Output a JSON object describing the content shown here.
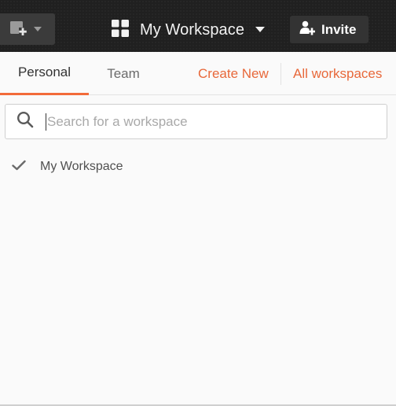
{
  "header": {
    "new_button": {
      "icon": "new-collection-plus-icon",
      "caret": "caret-down-icon"
    },
    "workspace_switcher": {
      "icon": "grid-icon",
      "title": "My Workspace",
      "caret": "caret-down-icon"
    },
    "invite_button": {
      "icon": "add-user-icon",
      "label": "Invite"
    }
  },
  "dropdown": {
    "tabs": [
      {
        "label": "Personal",
        "active": true
      },
      {
        "label": "Team",
        "active": false
      }
    ],
    "actions": {
      "create_new": "Create New",
      "all_workspaces": "All workspaces"
    },
    "search": {
      "placeholder": "Search for a workspace",
      "value": ""
    },
    "workspaces": [
      {
        "label": "My Workspace",
        "selected": true
      }
    ]
  },
  "colors": {
    "header_bg": "#202020",
    "accent": "#e8683a",
    "tab_indicator": "#f26b3a",
    "panel_bg": "#fafafa"
  }
}
